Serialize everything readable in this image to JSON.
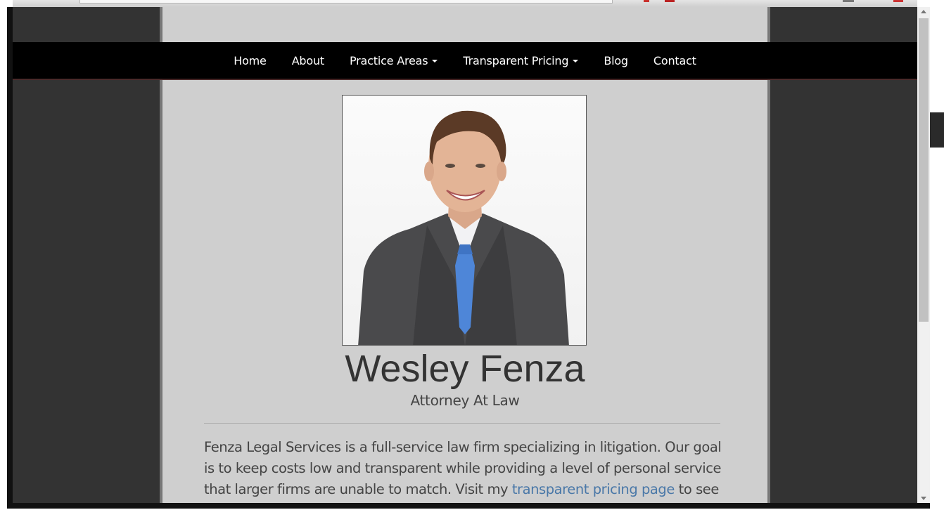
{
  "nav": {
    "items": [
      {
        "label": "Home"
      },
      {
        "label": "About"
      },
      {
        "label": "Practice Areas"
      },
      {
        "label": "Transparent Pricing"
      },
      {
        "label": "Blog"
      },
      {
        "label": "Contact"
      }
    ]
  },
  "hero": {
    "name": "Wesley Fenza",
    "subtitle": "Attorney At Law"
  },
  "intro": {
    "text_before": "Fenza Legal Services is a full-service law firm specializing in litigation. Our goal is to keep costs low and transparent while providing a level of personal service that larger firms are unable to match. Visit my ",
    "link": "transparent pricing page",
    "text_after": " to see exactly"
  },
  "colors": {
    "background": "#333333",
    "column": "#cfcfcf",
    "navbar": "#000000",
    "link": "#4a78a8"
  }
}
